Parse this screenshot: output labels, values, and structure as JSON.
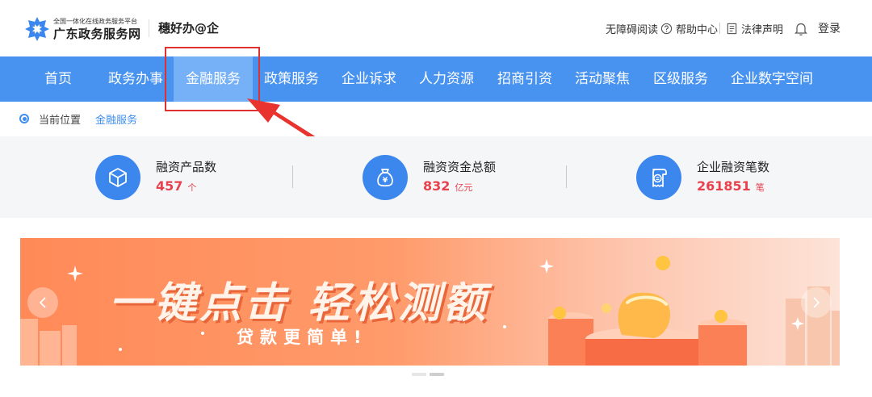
{
  "header": {
    "logo_small": "全国一体化在线政务服务平台",
    "logo_big": "广东政务服务网",
    "brand": "穗好办@企",
    "utils": {
      "accessibility": "无障碍阅读",
      "help": "帮助中心",
      "legal": "法律声明",
      "login": "登录"
    }
  },
  "nav": {
    "items": [
      "首页",
      "政务办事",
      "金融服务",
      "政策服务",
      "企业诉求",
      "人力资源",
      "招商引资",
      "活动聚焦",
      "区级服务",
      "企业数字空间"
    ],
    "active": "金融服务"
  },
  "breadcrumb": {
    "label": "当前位置",
    "current": "金融服务"
  },
  "stats": [
    {
      "icon": "cube-icon",
      "label": "融资产品数",
      "value": "457",
      "unit": "个"
    },
    {
      "icon": "money-bag-icon",
      "label": "融资资金总额",
      "value": "832",
      "unit": "亿元"
    },
    {
      "icon": "receipt-icon",
      "label": "企业融资笔数",
      "value": "261851",
      "unit": "笔"
    }
  ],
  "banner": {
    "title": "一键点击  轻松测额",
    "subtitle": "贷款更简单!"
  },
  "colors": {
    "nav": "#4993f0",
    "nav_active": "#76b0f6",
    "accent": "#3b87ee",
    "value_red": "#e8404d",
    "highlight": "#e03030"
  }
}
